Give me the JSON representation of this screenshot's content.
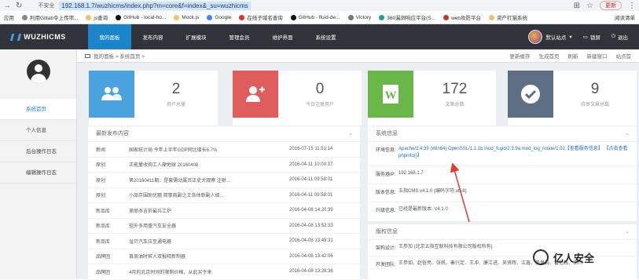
{
  "browser": {
    "security": "不安全",
    "url": "192.168.1.7/wuzhicms/index.php?m=core&f=index&_su=wuzhicms",
    "update_label": "更新",
    "bookmarks": [
      "应用",
      "利用Gitlab令上传项...",
      "js查询",
      "GitHub - local-ho...",
      "Mock.js",
      "Google",
      "在线子域名查询",
      "GitHub - fluid-de...",
      "Victory",
      "360漏洞响应平台(S...",
      "web攻防平台",
      "资产打猫系统"
    ],
    "reading_list": "阅读清单"
  },
  "topnav": {
    "logo": "WUZHICMS",
    "tabs": [
      "我的面板",
      "发布内容",
      "扩展模块",
      "管理会员",
      "维护界面",
      "系统设置"
    ],
    "site": "默认站点",
    "lock": "锁屏",
    "logout": "退出"
  },
  "sidebar": {
    "items": [
      "系统首页",
      "个人信息",
      "后台操作日志",
      "编辑操作日志"
    ]
  },
  "breadcrumb": {
    "path": "我的面板 > 系统首页 >",
    "links": [
      "更新缓存",
      "生成首页",
      "刷新",
      "新建窗口",
      "站点首"
    ]
  },
  "stats": [
    {
      "value": "2",
      "label": "用户总量",
      "color": "#4aa3df",
      "icon": "users-icon"
    },
    {
      "value": "0",
      "label": "今日注册用户",
      "color": "#e05d5d",
      "icon": "add-user-icon"
    },
    {
      "value": "172",
      "label": "文章总数",
      "color": "#6bb648",
      "icon": "document-icon"
    },
    {
      "value": "9",
      "label": "待审文章总数",
      "color": "#5e6f84",
      "icon": "check-icon"
    }
  ],
  "articles": {
    "title": "最新发布内容",
    "rows": [
      {
        "cat": "新闻",
        "title": "国家统计局:今年上半年GDP同比增长6.7%",
        "date": "2016-07-15 11:51:14"
      },
      {
        "cat": "原创",
        "title": "正能量收购工人硬地球 20160408",
        "date": "2016-04-11 10:00:37"
      },
      {
        "cat": "原创",
        "title": "第20160411期：是套需动属页正史大观察 注射...",
        "date": "2016-04-11 09:58:01"
      },
      {
        "cat": "原创",
        "title": "小品存围助优额 简事商副之王各体新副人级...",
        "date": "2016-04-11 09:58:01"
      },
      {
        "cat": "新品库",
        "title": "美丽多吉折最兵工炉",
        "date": "2016-04-08 14:20:39"
      },
      {
        "cat": "新品库",
        "title": "祖外多用盛汽车安全器",
        "date": "2016-04-08 13:52:33"
      },
      {
        "cat": "新品库",
        "title": "溢贝汽车应至通电器",
        "date": "2016-04-08 13:49:31"
      },
      {
        "cat": "品牌团",
        "title": "首周油时宾人双报释新制器",
        "date": "2016-04-08 13:42:06"
      },
      {
        "cat": "品牌团",
        "title": "4月的北京时间的限制价格，从此买于来",
        "date": "2016-04-08 13:28:36"
      }
    ]
  },
  "sysinfo": {
    "title": "系统信息",
    "env_label": "环境信息:",
    "env_value": "Apache/2.4.39 (Win64) OpenSSL/1.1.1b mod_fcgid/2.3.9a mod_log_rotate/1.02【查看服务信息】",
    "phpinfo": "【点击查看 phpinfo()】",
    "ip_label": "服务器IP:",
    "ip_value": "192.168.1.7",
    "version_label": "版本信息:",
    "version_value": "五指CMS v4.1.0 (编码字符:utf-8)",
    "upgrade_label": "升级信息:",
    "upgrade_value": "已经是最新版本: V4.1.0"
  },
  "credits": {
    "title": "版权信息",
    "design_label": "架构设计:",
    "design_value": "王参加 (北京五指互联科技有限公司版权所有)",
    "team_label": "开发团队:",
    "team_value": "王参如、赵俗亮、张帆、秦兴定、王冲、廉江进、吴贤辉、江鑫、美量云、雷范线、郝川"
  },
  "watermark": "亿人安全",
  "colors": {
    "accent": "#1c85c9",
    "topbar": "#30343a",
    "arrow": "#e53935"
  }
}
